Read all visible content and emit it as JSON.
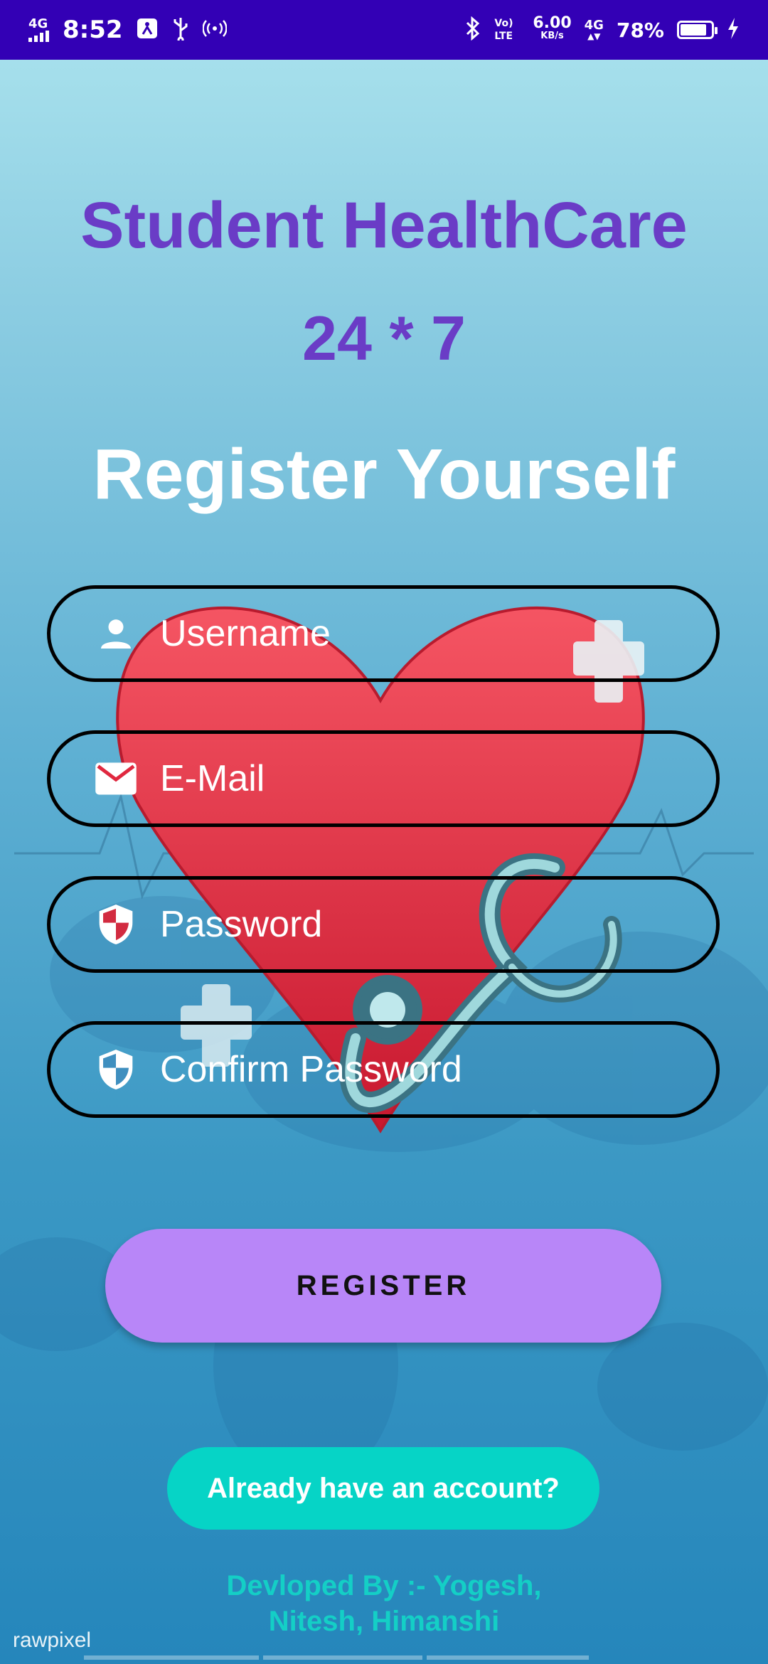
{
  "status_bar": {
    "network_type": "4G",
    "time": "8:52",
    "volte": "Vo) LTE",
    "speed_value": "6.00",
    "speed_unit": "KB/s",
    "network_type_2": "4G",
    "battery_percent": "78%",
    "battery_level": 0.78
  },
  "header": {
    "app_name": "Student HealthCare",
    "availability": "24 * 7",
    "heading": "Register Yourself"
  },
  "form": {
    "username": {
      "placeholder": "Username",
      "value": "",
      "icon": "person-icon"
    },
    "email": {
      "placeholder": "E-Mail",
      "value": "",
      "icon": "mail-icon"
    },
    "password": {
      "placeholder": "Password",
      "value": "",
      "icon": "shield-icon"
    },
    "confirm_password": {
      "placeholder": "Confirm Password",
      "value": "",
      "icon": "shield-icon"
    }
  },
  "buttons": {
    "register": "REGISTER",
    "login_link": "Already have an account?"
  },
  "footer": {
    "credits_line1": "Devloped By :-  Yogesh,",
    "credits_line2": "Nitesh, Himanshi",
    "watermark": "rawpixel"
  },
  "colors": {
    "status_bar": "#3300b5",
    "title": "#6a3cc6",
    "register_button": "#b886f8",
    "account_button": "#06d4c6",
    "credits": "#14cfc6",
    "heart": "#e0283f"
  }
}
